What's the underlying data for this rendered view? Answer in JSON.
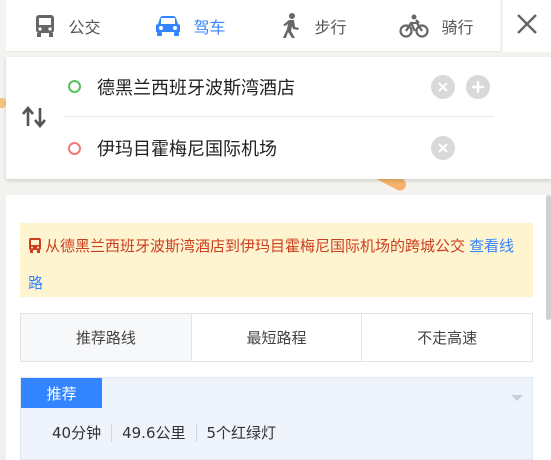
{
  "tabs": [
    {
      "label": "公交",
      "icon": "bus-icon"
    },
    {
      "label": "驾车",
      "icon": "car-icon",
      "active": true
    },
    {
      "label": "步行",
      "icon": "walk-icon"
    },
    {
      "label": "骑行",
      "icon": "bike-icon"
    }
  ],
  "route": {
    "start": "德黑兰西班牙波斯湾酒店",
    "end": "伊玛目霍梅尼国际机场"
  },
  "notice": {
    "text": "从德黑兰西班牙波斯湾酒店到伊玛目霍梅尼国际机场的跨城公交",
    "link": "查看线路"
  },
  "route_options": [
    "推荐路线",
    "最短路程",
    "不走高速"
  ],
  "plan": {
    "badge": "推荐",
    "duration": "40分钟",
    "distance": "49.6公里",
    "traffic_lights": "5个红绿灯"
  },
  "colors": {
    "accent": "#3385ff",
    "notice_bg": "#fff4d0",
    "notice_text": "#cc3d1e",
    "start_dot": "#58c35c",
    "end_dot": "#f07a7a"
  }
}
